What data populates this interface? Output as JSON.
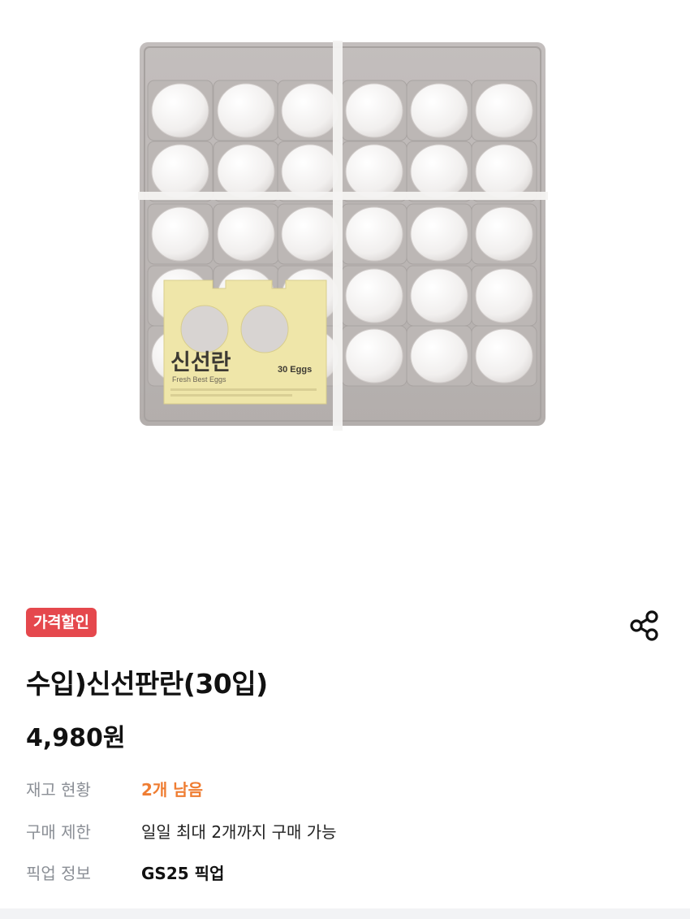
{
  "product": {
    "image_alt": "수입)신선판란(30입)",
    "package_label": {
      "brand_text": "신선란",
      "sub_text": "Fresh Best Eggs",
      "count_text": "30 Eggs"
    },
    "badge": "가격할인",
    "title": "수입)신선판란(30입)",
    "price": "4,980원"
  },
  "info": [
    {
      "label": "재고 현황",
      "value": "2개 남음"
    },
    {
      "label": "구매 제한",
      "value": "일일 최대 2개까지 구매 가능"
    },
    {
      "label": "픽업 정보",
      "value": "GS25 픽업"
    }
  ],
  "icons": {
    "share": "share-icon"
  },
  "colors": {
    "badge": "#e5484d",
    "stock": "#ef7d32",
    "label": "#8b8f96"
  }
}
